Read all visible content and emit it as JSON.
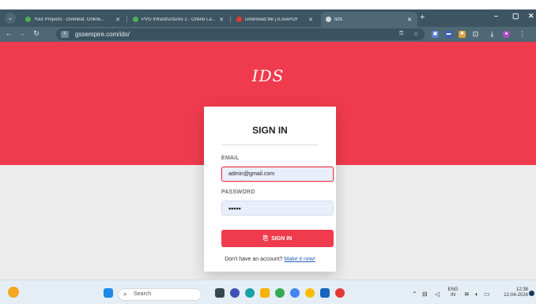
{
  "browser": {
    "tabs": [
      {
        "title": "Your Projects - Overleaf, Online...",
        "active": false
      },
      {
        "title": "PVG Infrastructures 2 - Online La...",
        "active": false
      },
      {
        "title": "Download file | iLovePDF",
        "active": false
      },
      {
        "title": "IDS",
        "active": true
      }
    ],
    "new_tab_label": "+",
    "menu_icon": "chevron-down-icon",
    "url": "gssempire.com/ids/",
    "window_controls": {
      "minimize": "–",
      "maximize": "▢",
      "close": "✕"
    }
  },
  "page": {
    "logo": "IDS",
    "card": {
      "title": "SIGN IN",
      "email_label": "EMAIL",
      "email_value": "admin@gmail.com",
      "password_label": "PASSWORD",
      "password_value": "•••••",
      "button_label": "SIGN IN",
      "signup_text": "Don't have an account?",
      "signup_link": "Make it now!"
    },
    "colors": {
      "accent": "#ef3b4d",
      "background": "#ececec",
      "input_bg": "#e8effb"
    }
  },
  "taskbar": {
    "search_placeholder": "Search",
    "lang_top": "ENG",
    "lang_bottom": "IN",
    "time": "12:38",
    "date": "12-04-2024"
  }
}
